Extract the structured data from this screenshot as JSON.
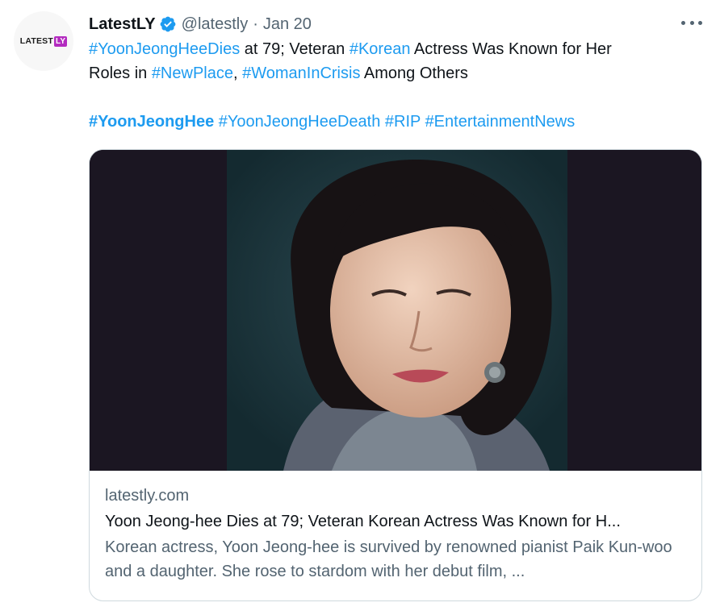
{
  "author": {
    "avatar_logo": "LATEST",
    "avatar_logo_box": "LY",
    "name": "LatestLY",
    "handle": "@latestly",
    "date": "Jan 20",
    "verified_icon": "verified-badge-icon",
    "verified_color": "#1d9bf0"
  },
  "tweet": {
    "line1": {
      "tag1": "#YoonJeongHeeDies",
      "t1": " at 79; Veteran ",
      "tag2": "#Korean",
      "t2": " Actress Was Known for Her"
    },
    "line2": {
      "t1": "Roles in ",
      "tag1": "#NewPlace",
      "t2": ", ",
      "tag2": "#WomanInCrisis",
      "t3": " Among Others"
    },
    "line3": {
      "tag1": "#YoonJeongHee",
      "tag2": "#YoonJeongHeeDeath",
      "tag3": "#RIP",
      "tag4": "#EntertainmentNews"
    },
    "hashtag_color": "#1d9bf0"
  },
  "card": {
    "domain": "latestly.com",
    "title": "Yoon Jeong-hee Dies at 79; Veteran Korean Actress Was Known for H...",
    "description": "Korean actress, Yoon Jeong-hee is survived by renowned pianist Paik Kun-woo and a daughter. She rose to stardom with her debut film, ..."
  },
  "menu_icon": "more-dots-icon"
}
